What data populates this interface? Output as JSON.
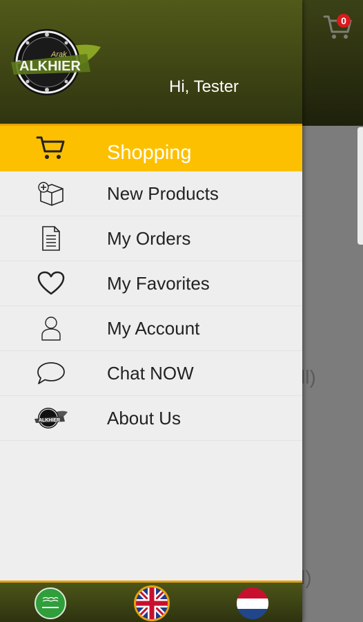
{
  "app": {
    "cart_count": "0",
    "bg_text_1": "ll)",
    "bg_text_2": "l)"
  },
  "drawer": {
    "greeting": "Hi, Tester",
    "logo": {
      "brand": "ALKHIER",
      "sub": "Arak"
    },
    "items": [
      {
        "label": "Shopping",
        "icon": "cart-icon",
        "active": true
      },
      {
        "label": "New Products",
        "icon": "new-box-icon",
        "active": false
      },
      {
        "label": "My Orders",
        "icon": "document-icon",
        "active": false
      },
      {
        "label": "My Favorites",
        "icon": "heart-icon",
        "active": false
      },
      {
        "label": "My Account",
        "icon": "person-icon",
        "active": false
      },
      {
        "label": "Chat NOW",
        "icon": "chat-bubble-icon",
        "active": false
      },
      {
        "label": "About Us",
        "icon": "brand-logo-icon",
        "active": false
      }
    ],
    "languages": [
      {
        "name": "arabic-flag-icon",
        "selected": false
      },
      {
        "name": "english-flag-icon",
        "selected": true
      },
      {
        "name": "dutch-flag-icon",
        "selected": false
      }
    ]
  },
  "colors": {
    "header_olive": "#515a19",
    "accent_yellow": "#fdc000",
    "accent_orange": "#e8a20b",
    "drawer_bg": "#eeeeee"
  }
}
